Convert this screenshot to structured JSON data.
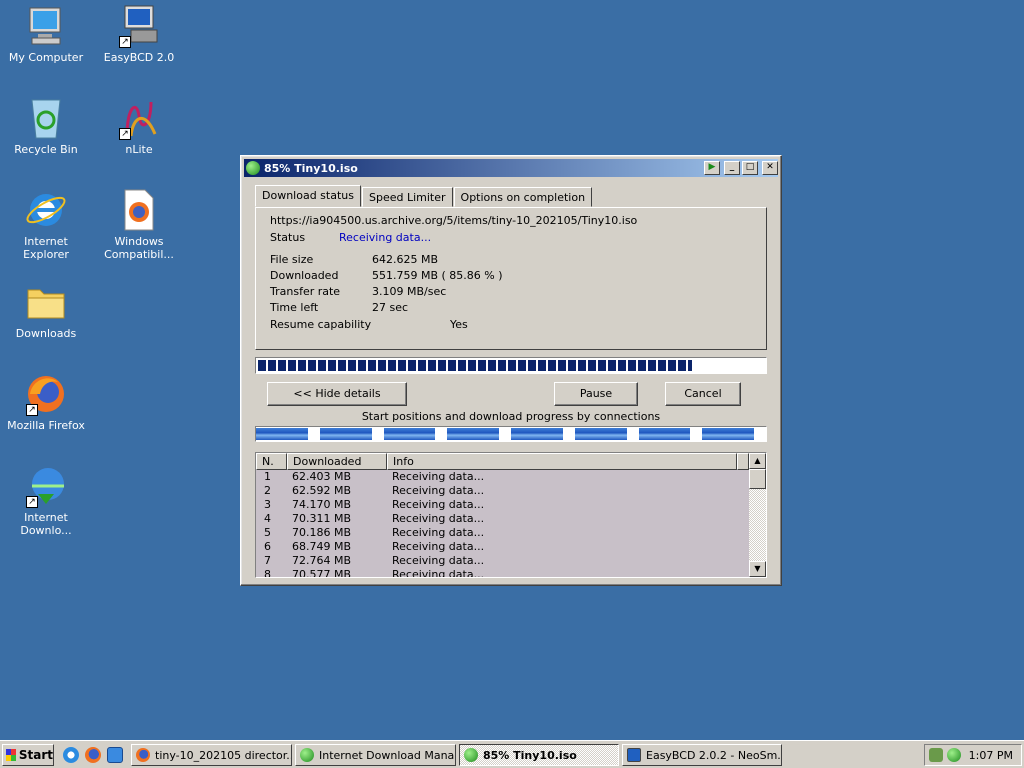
{
  "desktop": {
    "icons": [
      {
        "label": "My Computer",
        "icon": "computer-icon"
      },
      {
        "label": "EasyBCD 2.0",
        "icon": "easybcd-icon"
      },
      {
        "label": "Recycle Bin",
        "icon": "recycle-bin-icon"
      },
      {
        "label": "nLite",
        "icon": "nlite-icon"
      },
      {
        "label": "Internet Explorer",
        "icon": "internet-explorer-icon"
      },
      {
        "label": "Windows Compatibil...",
        "icon": "firefox-document-icon"
      },
      {
        "label": "Downloads",
        "icon": "folder-icon"
      },
      {
        "label": "Mozilla Firefox",
        "icon": "firefox-icon"
      },
      {
        "label": "Internet Downlo...",
        "icon": "idm-icon"
      }
    ]
  },
  "window": {
    "title": "85% Tiny10.iso",
    "tabs": [
      {
        "label": "Download status",
        "active": true
      },
      {
        "label": "Speed Limiter",
        "active": false
      },
      {
        "label": "Options on completion",
        "active": false
      }
    ],
    "url": "https://ia904500.us.archive.org/5/items/tiny-10_202105/Tiny10.iso",
    "status_label": "Status",
    "status_value": "Receiving data...",
    "fields": {
      "file_size": {
        "label": "File size",
        "value": "642.625  MB"
      },
      "downloaded": {
        "label": "Downloaded",
        "value": "551.759  MB  ( 85.86 % )"
      },
      "transfer_rate": {
        "label": "Transfer rate",
        "value": "3.109  MB/sec"
      },
      "time_left": {
        "label": "Time left",
        "value": "27 sec"
      },
      "resume": {
        "label": "Resume capability",
        "value": "Yes"
      }
    },
    "progress_percent": 85.86,
    "buttons": {
      "hide_details": "<< Hide details",
      "pause": "Pause",
      "cancel": "Cancel"
    },
    "connections_caption": "Start positions and download progress by connections",
    "connection_segments": 8,
    "list": {
      "columns": [
        "N.",
        "Downloaded",
        "Info"
      ],
      "rows": [
        {
          "n": "1",
          "downloaded": "62.403  MB",
          "info": "Receiving data..."
        },
        {
          "n": "2",
          "downloaded": "62.592  MB",
          "info": "Receiving data..."
        },
        {
          "n": "3",
          "downloaded": "74.170  MB",
          "info": "Receiving data..."
        },
        {
          "n": "4",
          "downloaded": "70.311  MB",
          "info": "Receiving data..."
        },
        {
          "n": "5",
          "downloaded": "70.186  MB",
          "info": "Receiving data..."
        },
        {
          "n": "6",
          "downloaded": "68.749  MB",
          "info": "Receiving data..."
        },
        {
          "n": "7",
          "downloaded": "72.764  MB",
          "info": "Receiving data..."
        },
        {
          "n": "8",
          "downloaded": "70.577  MB",
          "info": "Receiving data..."
        }
      ]
    }
  },
  "taskbar": {
    "start_label": "Start",
    "tasks": [
      {
        "label": "tiny-10_202105 director...",
        "icon": "firefox-icon",
        "active": false
      },
      {
        "label": "Internet Download Mana...",
        "icon": "idm-icon",
        "active": false
      },
      {
        "label": "85% Tiny10.iso",
        "icon": "idm-icon",
        "active": true
      },
      {
        "label": "EasyBCD 2.0.2 - NeoSm...",
        "icon": "easybcd-icon",
        "active": false
      }
    ],
    "clock": "1:07 PM"
  },
  "colors": {
    "desktop": "#3a6ea5",
    "titlebar": "#0a246a",
    "progress": "#0a246a",
    "status_text": "#0000c0"
  }
}
